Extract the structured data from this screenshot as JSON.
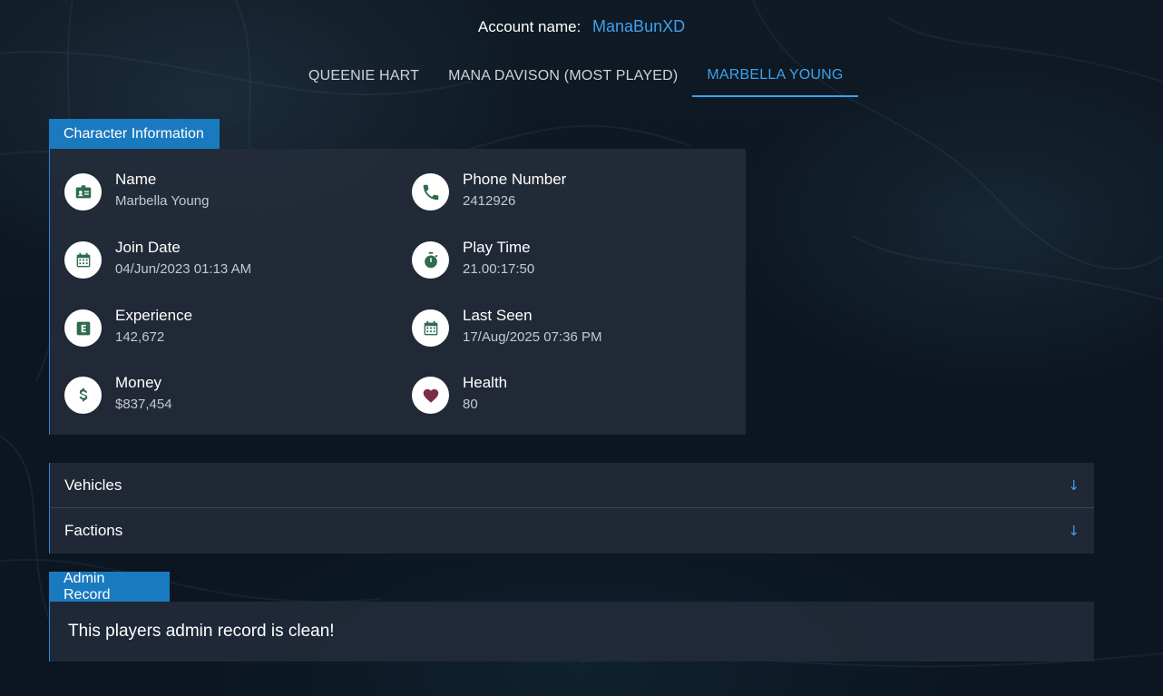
{
  "account": {
    "label": "Account name:",
    "name": "ManaBunXD"
  },
  "tabs": [
    {
      "label": "QUEENIE HART",
      "active": false
    },
    {
      "label": "MANA DAVISON (MOST PLAYED)",
      "active": false
    },
    {
      "label": "MARBELLA YOUNG",
      "active": true
    }
  ],
  "character_info": {
    "title": "Character Information",
    "items": [
      {
        "label": "Name",
        "value": "Marbella Young",
        "icon": "id-card-icon",
        "icon_color": "#2e6b4f"
      },
      {
        "label": "Phone Number",
        "value": "2412926",
        "icon": "phone-icon",
        "icon_color": "#2e6b4f"
      },
      {
        "label": "Join Date",
        "value": "04/Jun/2023 01:13 AM",
        "icon": "calendar-icon",
        "icon_color": "#2e6b4f"
      },
      {
        "label": "Play Time",
        "value": "21.00:17:50",
        "icon": "stopwatch-icon",
        "icon_color": "#2e6b4f"
      },
      {
        "label": "Experience",
        "value": "142,672",
        "icon": "experience-icon",
        "icon_color": "#2e6b4f"
      },
      {
        "label": "Last Seen",
        "value": "17/Aug/2025 07:36 PM",
        "icon": "calendar-icon",
        "icon_color": "#2e6b4f"
      },
      {
        "label": "Money",
        "value": "$837,454",
        "icon": "dollar-icon",
        "icon_color": "#2e6b4f"
      },
      {
        "label": "Health",
        "value": "80",
        "icon": "heart-icon",
        "icon_color": "#7a2d4a"
      }
    ]
  },
  "sections": {
    "vehicles": {
      "label": "Vehicles",
      "arrow": "↓"
    },
    "factions": {
      "label": "Factions",
      "arrow": "↓"
    }
  },
  "admin_record": {
    "title": "Admin Record",
    "message": "This players admin record is clean!"
  },
  "colors": {
    "accent": "#3ea0ee",
    "section_header": "#1a7ac0",
    "icon_green": "#2e6b4f",
    "icon_heart": "#7a2d4a"
  }
}
